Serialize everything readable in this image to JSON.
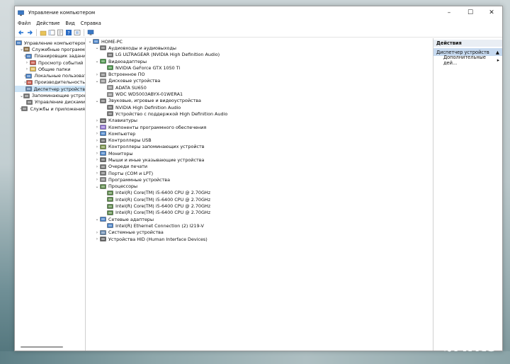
{
  "window": {
    "title": "Управление компьютером"
  },
  "menu": [
    "Файл",
    "Действие",
    "Вид",
    "Справка"
  ],
  "left_tree": [
    {
      "label": "Управление компьютером (л",
      "level": 0,
      "chev": "",
      "icon": "computer-management-icon"
    },
    {
      "label": "Служебные программы",
      "level": 1,
      "chev": "v",
      "icon": "tools-icon"
    },
    {
      "label": "Планировщик заданий",
      "level": 2,
      "chev": ">",
      "icon": "scheduler-icon"
    },
    {
      "label": "Просмотр событий",
      "level": 2,
      "chev": ">",
      "icon": "event-viewer-icon"
    },
    {
      "label": "Общие папки",
      "level": 2,
      "chev": ">",
      "icon": "shared-folders-icon"
    },
    {
      "label": "Локальные пользовате",
      "level": 2,
      "chev": ">",
      "icon": "users-icon"
    },
    {
      "label": "Производительность",
      "level": 2,
      "chev": ">",
      "icon": "performance-icon"
    },
    {
      "label": "Диспетчер устройств",
      "level": 2,
      "chev": "",
      "icon": "device-manager-icon",
      "selected": true
    },
    {
      "label": "Запоминающие устройства",
      "level": 1,
      "chev": "v",
      "icon": "storage-icon"
    },
    {
      "label": "Управление дисками",
      "level": 2,
      "chev": "",
      "icon": "disk-icon"
    },
    {
      "label": "Службы и приложения",
      "level": 1,
      "chev": ">",
      "icon": "services-icon"
    }
  ],
  "device_tree": [
    {
      "label": "HOME-PC",
      "level": 0,
      "chev": "v",
      "icon": "computer-icon"
    },
    {
      "label": "Аудиовходы и аудиовыходы",
      "level": 1,
      "chev": "v",
      "icon": "audio-icon"
    },
    {
      "label": "LG ULTRAGEAR (NVIDIA High Definition Audio)",
      "level": 2,
      "chev": "",
      "icon": "audio-icon"
    },
    {
      "label": "Видеоадаптеры",
      "level": 1,
      "chev": "v",
      "icon": "display-adapter-icon"
    },
    {
      "label": "NVIDIA GeForce GTX 1050 Ti",
      "level": 2,
      "chev": "",
      "icon": "display-adapter-icon"
    },
    {
      "label": "Встроенное ПО",
      "level": 1,
      "chev": ">",
      "icon": "firmware-icon"
    },
    {
      "label": "Дисковые устройства",
      "level": 1,
      "chev": "v",
      "icon": "disk-drive-icon"
    },
    {
      "label": "ADATA SU650",
      "level": 2,
      "chev": "",
      "icon": "disk-drive-icon"
    },
    {
      "label": "WDC WD5003ABYX-01WERA1",
      "level": 2,
      "chev": "",
      "icon": "disk-drive-icon"
    },
    {
      "label": "Звуковые, игровые и видеоустройства",
      "level": 1,
      "chev": "v",
      "icon": "sound-icon"
    },
    {
      "label": "NVIDIA High Definition Audio",
      "level": 2,
      "chev": "",
      "icon": "sound-icon"
    },
    {
      "label": "Устройство с поддержкой High Definition Audio",
      "level": 2,
      "chev": "",
      "icon": "sound-icon"
    },
    {
      "label": "Клавиатуры",
      "level": 1,
      "chev": ">",
      "icon": "keyboard-icon"
    },
    {
      "label": "Компоненты программного обеспечения",
      "level": 1,
      "chev": ">",
      "icon": "software-component-icon"
    },
    {
      "label": "Компьютер",
      "level": 1,
      "chev": ">",
      "icon": "computer-icon"
    },
    {
      "label": "Контроллеры USB",
      "level": 1,
      "chev": ">",
      "icon": "usb-icon"
    },
    {
      "label": "Контроллеры запоминающих устройств",
      "level": 1,
      "chev": ">",
      "icon": "storage-controller-icon"
    },
    {
      "label": "Мониторы",
      "level": 1,
      "chev": ">",
      "icon": "monitor-icon"
    },
    {
      "label": "Мыши и иные указывающие устройства",
      "level": 1,
      "chev": ">",
      "icon": "mouse-icon"
    },
    {
      "label": "Очереди печати",
      "level": 1,
      "chev": ">",
      "icon": "print-queue-icon"
    },
    {
      "label": "Порты (COM и LPT)",
      "level": 1,
      "chev": ">",
      "icon": "port-icon"
    },
    {
      "label": "Программные устройства",
      "level": 1,
      "chev": ">",
      "icon": "software-device-icon"
    },
    {
      "label": "Процессоры",
      "level": 1,
      "chev": "v",
      "icon": "processor-icon"
    },
    {
      "label": "Intel(R) Core(TM) i5-6400 CPU @ 2.70GHz",
      "level": 2,
      "chev": "",
      "icon": "processor-icon"
    },
    {
      "label": "Intel(R) Core(TM) i5-6400 CPU @ 2.70GHz",
      "level": 2,
      "chev": "",
      "icon": "processor-icon"
    },
    {
      "label": "Intel(R) Core(TM) i5-6400 CPU @ 2.70GHz",
      "level": 2,
      "chev": "",
      "icon": "processor-icon"
    },
    {
      "label": "Intel(R) Core(TM) i5-6400 CPU @ 2.70GHz",
      "level": 2,
      "chev": "",
      "icon": "processor-icon"
    },
    {
      "label": "Сетевые адаптеры",
      "level": 1,
      "chev": "v",
      "icon": "network-icon"
    },
    {
      "label": "Intel(R) Ethernet Connection (2) I219-V",
      "level": 2,
      "chev": "",
      "icon": "network-icon"
    },
    {
      "label": "Системные устройства",
      "level": 1,
      "chev": ">",
      "icon": "system-device-icon"
    },
    {
      "label": "Устройства HID (Human Interface Devices)",
      "level": 1,
      "chev": ">",
      "icon": "hid-icon"
    }
  ],
  "actions": {
    "header": "Действия",
    "selected": "Диспетчер устройств",
    "more": "Дополнительные дей..."
  },
  "watermark": "Avito",
  "colors": {
    "selection": "#cce4f7",
    "action_selected": "#c7daf0",
    "actions_header": "#e9eef4"
  }
}
